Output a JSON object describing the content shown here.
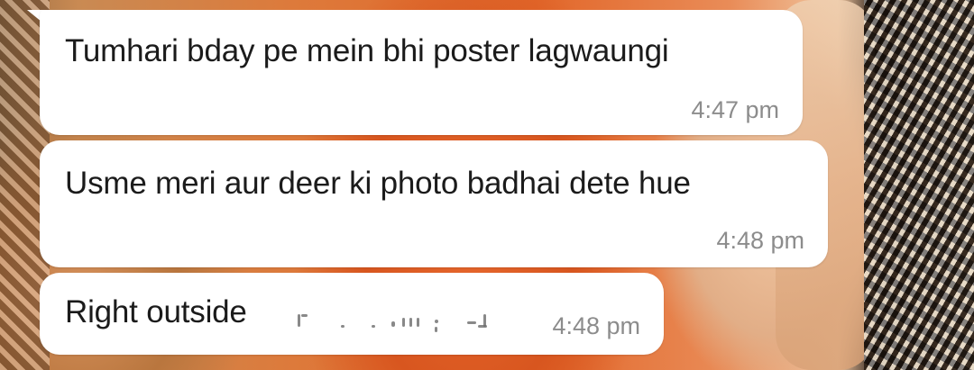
{
  "messages": [
    {
      "text": "Tumhari bday pe mein bhi poster lagwaungi",
      "time": "4:47 pm"
    },
    {
      "text": "Usme meri aur deer ki photo badhai dete hue",
      "time": "4:48 pm"
    },
    {
      "text": "Right outside",
      "time": "4:48 pm",
      "redacted": true
    }
  ],
  "colors": {
    "bubble": "#ffffff",
    "text": "#1b1b1b",
    "timestamp": "#8c8c8c",
    "background_accent": "#e2672a"
  }
}
